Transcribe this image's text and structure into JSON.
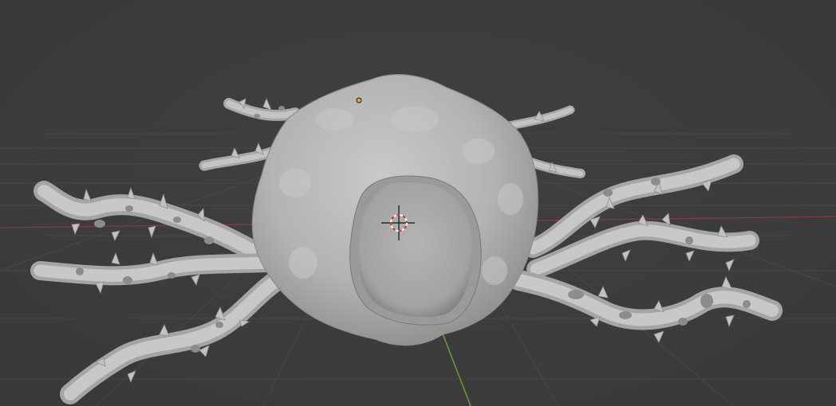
{
  "viewport": {
    "mode": "3d-viewport",
    "shading": "solid",
    "background_color": "#3d3d3d",
    "grid_line_color": "#4a4a4a",
    "x_axis_color": "#8a3a43",
    "y_axis_color": "#6b9a3a",
    "origin_color": "#f0a020",
    "object_color": "#b9b9b9",
    "object": "creature-mesh-with-thorny-tentacles"
  }
}
